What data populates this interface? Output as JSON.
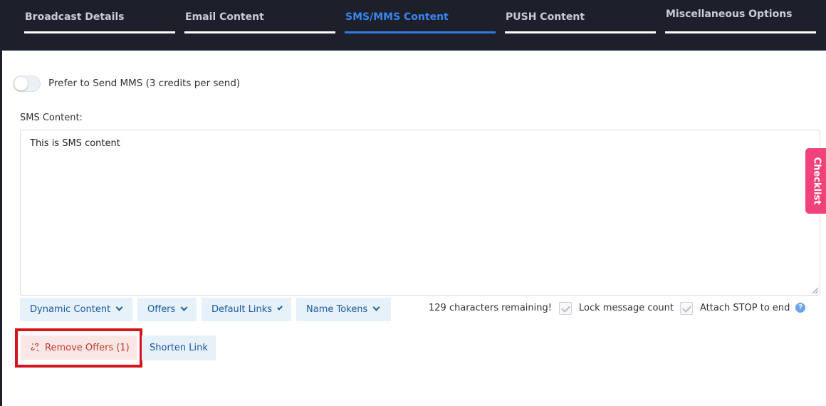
{
  "tabs": [
    {
      "label": "Broadcast Details",
      "active": false
    },
    {
      "label": "Email Content",
      "active": false
    },
    {
      "label": "SMS/MMS Content",
      "active": true
    },
    {
      "label": "PUSH Content",
      "active": false
    },
    {
      "label": "Miscellaneous Options",
      "active": false
    }
  ],
  "mms_toggle": {
    "label": "Prefer to Send MMS (3 credits per send)",
    "on": false
  },
  "sms": {
    "label": "SMS Content:",
    "value": "This is SMS content"
  },
  "toolbar": {
    "dropdowns": [
      {
        "label": "Dynamic Content"
      },
      {
        "label": "Offers"
      },
      {
        "label": "Default Links"
      },
      {
        "label": "Name Tokens"
      }
    ],
    "remaining": "129 characters remaining!",
    "lock_label": "Lock message count",
    "stop_label": "Attach STOP to end",
    "help": "?"
  },
  "actions": {
    "remove_offers": "Remove Offers (1)",
    "shorten_link": "Shorten Link"
  },
  "checklist": {
    "label": "Checklist"
  },
  "colors": {
    "tabbar_bg": "#1d1f2b",
    "active_tab": "#3a86ef",
    "button_bg": "#e6f1fa",
    "button_text": "#1b5aa3",
    "remove_bg": "#fbe6e6",
    "remove_text": "#c23b2b",
    "highlight": "#d6141c",
    "checklist_bg": "#f2427b"
  }
}
